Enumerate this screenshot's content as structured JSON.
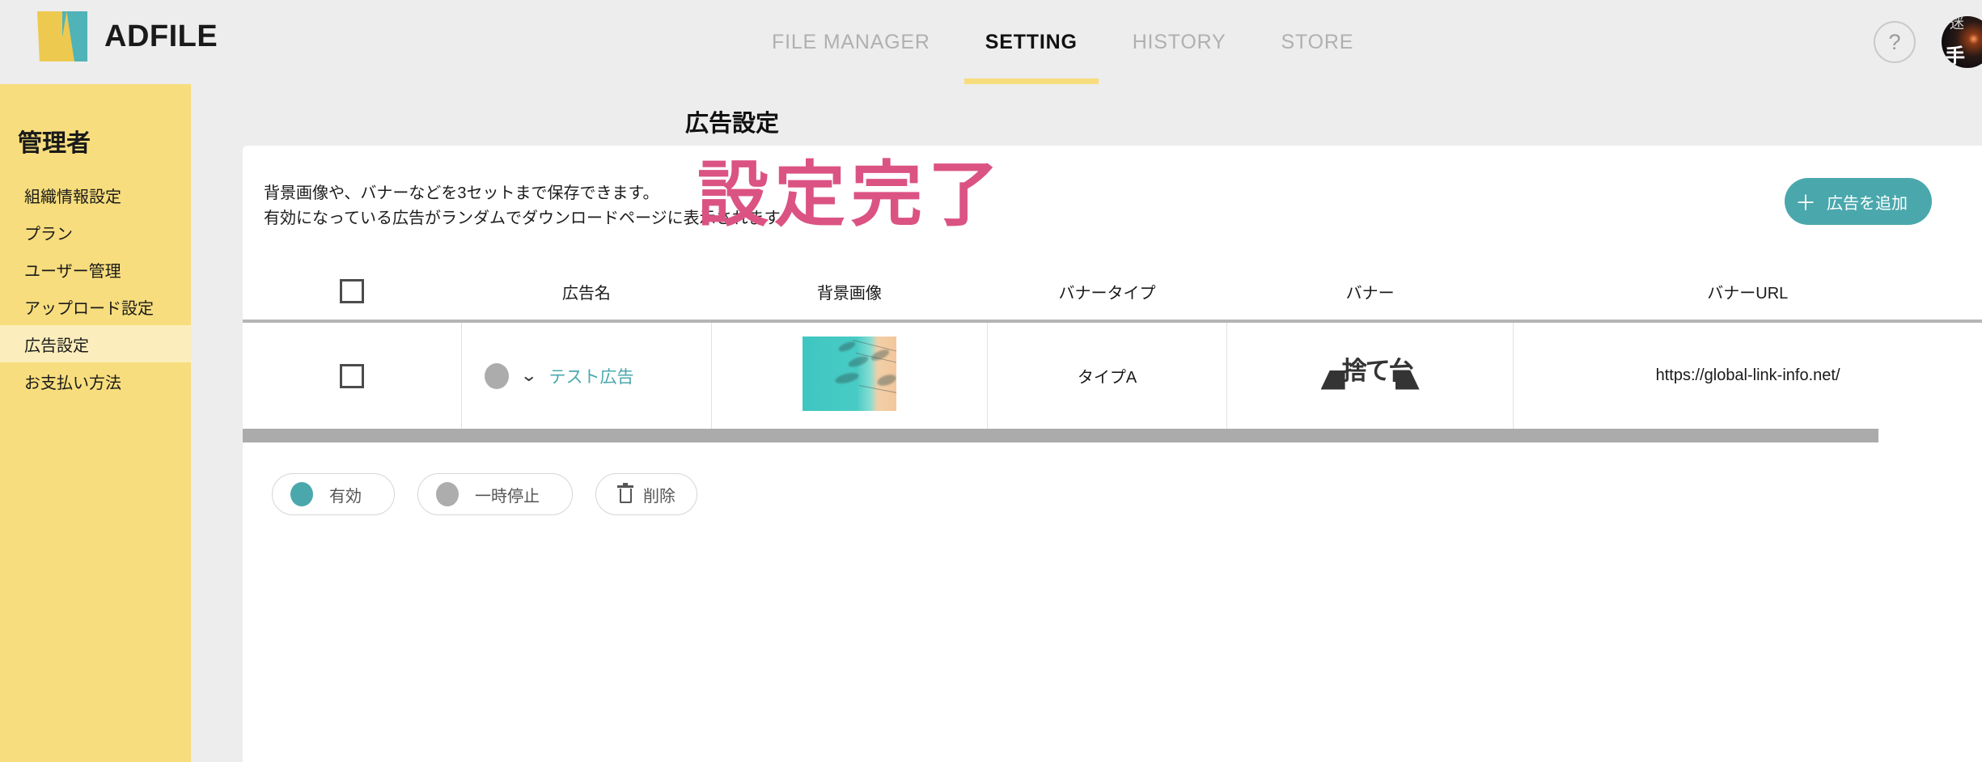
{
  "header": {
    "brand_name": "ADFILE",
    "nav": [
      {
        "label": "FILE MANAGER",
        "active": false
      },
      {
        "label": "SETTING",
        "active": true
      },
      {
        "label": "HISTORY",
        "active": false
      },
      {
        "label": "STORE",
        "active": false
      }
    ],
    "help_icon_label": "?",
    "help_icon_name": "question-mark-icon",
    "avatar_name": "user-avatar"
  },
  "sidebar": {
    "title": "管理者",
    "items": [
      {
        "label": "組織情報設定",
        "active": false
      },
      {
        "label": "プラン",
        "active": false
      },
      {
        "label": "ユーザー管理",
        "active": false
      },
      {
        "label": "アップロード設定",
        "active": false
      },
      {
        "label": "広告設定",
        "active": true
      },
      {
        "label": "お支払い方法",
        "active": false
      }
    ]
  },
  "main": {
    "page_title": "広告設定",
    "description_line1": "背景画像や、バナーなどを3セットまで保存できます。",
    "description_line2": "有効になっている広告がランダムでダウンロードページに表示されます。",
    "add_button": {
      "plus": "＋",
      "label": "広告を追加"
    },
    "completion_overlay": "設定完了"
  },
  "table": {
    "columns": [
      {
        "key": "check",
        "label": ""
      },
      {
        "key": "name",
        "label": "広告名"
      },
      {
        "key": "background",
        "label": "背景画像"
      },
      {
        "key": "banner_type",
        "label": "バナータイプ"
      },
      {
        "key": "banner",
        "label": "バナー"
      },
      {
        "key": "banner_url",
        "label": "バナーURL"
      }
    ],
    "rows": [
      {
        "checked": false,
        "status": "paused",
        "name": "テスト広告",
        "background_image_alt": "beach-aerial-thumbnail",
        "banner_type": "タイプA",
        "banner_image_alt": "dark-banner-thumbnail",
        "banner_url": "https://global-link-info.net/"
      }
    ]
  },
  "footer_actions": [
    {
      "label": "有効",
      "dot": "on",
      "icon": ""
    },
    {
      "label": "一時停止",
      "dot": "off",
      "icon": ""
    },
    {
      "label": "削除",
      "dot": "",
      "icon": "trash-icon"
    }
  ],
  "colors": {
    "brand_yellow": "#f7dd7d",
    "brand_yellow_light": "#fbeebc",
    "accent_teal": "#4aa8ad",
    "overlay_pink": "#db5383",
    "page_bg": "#ededed"
  }
}
